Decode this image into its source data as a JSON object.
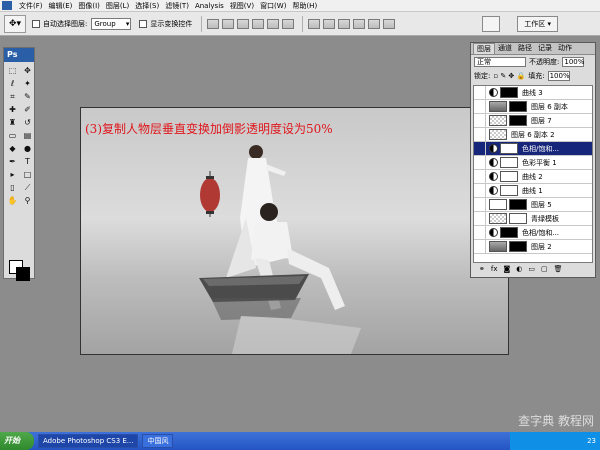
{
  "menubar": {
    "items": [
      "文件(F)",
      "编辑(E)",
      "图像(I)",
      "图层(L)",
      "选择(S)",
      "滤镜(T)",
      "Analysis",
      "视图(V)",
      "窗口(W)",
      "帮助(H)"
    ]
  },
  "optionsbar": {
    "auto_select_label": "自动选择图层:",
    "group_value": "Group",
    "transform_label": "显示变换控件",
    "workspace_label": "工作区 ▾"
  },
  "toolbox": {
    "header": "Ps"
  },
  "canvas": {
    "caption": "(3)复制人物层垂直变换加倒影透明度设为50%"
  },
  "layers_panel": {
    "tabs": [
      "图层",
      "通道",
      "路径",
      "记录",
      "动作"
    ],
    "blend_mode": "正常",
    "opacity_label": "不透明度:",
    "opacity_value": "100%",
    "lock_label": "锁定:",
    "fill_label": "填充:",
    "fill_value": "100%",
    "layers": [
      {
        "name": "曲线 3"
      },
      {
        "name": "图层 6 副本"
      },
      {
        "name": "图层 7"
      },
      {
        "name": "图层 6 副本 2"
      },
      {
        "name": "色相/饱和..."
      },
      {
        "name": "色彩平衡 1"
      },
      {
        "name": "曲线 2"
      },
      {
        "name": "曲线 1"
      },
      {
        "name": "图层 5"
      },
      {
        "name": "青绿模板"
      },
      {
        "name": "色相/饱和..."
      },
      {
        "name": "图层 2"
      }
    ]
  },
  "taskbar": {
    "start": "开始",
    "tasks": [
      "Adobe Photoshop CS3 E...",
      "中国风"
    ],
    "tray_text": "23"
  },
  "watermark": "查字典 教程网"
}
